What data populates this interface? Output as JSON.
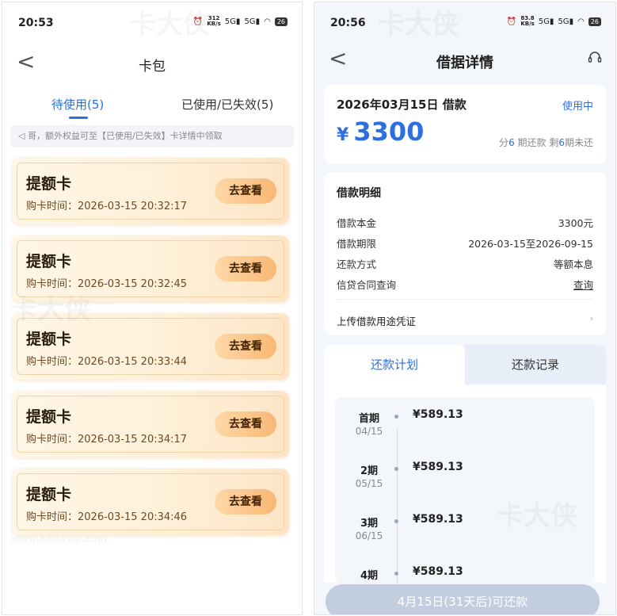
{
  "left": {
    "status": {
      "time": "20:53",
      "speed_top": "312",
      "speed_unit": "KB/s",
      "net1": "5G",
      "net2": "5G",
      "battery": "26"
    },
    "nav": {
      "back": "<",
      "title": "卡包"
    },
    "tabs": [
      {
        "label": "待使用(5)"
      },
      {
        "label": "已使用/已失效(5)"
      }
    ],
    "notice": "◁ 哥，额外权益可至【已使用/已失效】卡详情中领取",
    "cards": [
      {
        "name": "提额卡",
        "time": "购卡时间：2026-03-15 20:32:17",
        "button": "去查看"
      },
      {
        "name": "提额卡",
        "time": "购卡时间：2026-03-15 20:32:45",
        "button": "去查看"
      },
      {
        "name": "提额卡",
        "time": "购卡时间：2026-03-15 20:33:44",
        "button": "去查看"
      },
      {
        "name": "提额卡",
        "time": "购卡时间：2026-03-15 20:34:17",
        "button": "去查看"
      },
      {
        "name": "提额卡",
        "time": "购卡时间：2026-03-15 20:34:46",
        "button": "去查看"
      }
    ]
  },
  "right": {
    "status": {
      "time": "20:56",
      "speed_top": "83.8",
      "speed_unit": "KB/s",
      "net1": "5G",
      "net2": "5G",
      "battery": "26"
    },
    "nav": {
      "back": "<",
      "title": "借据详情",
      "support_icon": "headset-icon"
    },
    "loan": {
      "title": "2026年03月15日 借款",
      "status": "使用中",
      "currency": "¥",
      "amount": "3300",
      "sub_pre": "分",
      "sub_n1": "6",
      "sub_mid": " 期还款 剩",
      "sub_n2": "6",
      "sub_post": "期未还"
    },
    "detail": {
      "heading": "借款明细",
      "rows": [
        {
          "key": "借款本金",
          "value": "3300元"
        },
        {
          "key": "借款期限",
          "value": "2026-03-15至2026-09-15"
        },
        {
          "key": "还款方式",
          "value": "等额本息"
        },
        {
          "key": "信贷合同查询",
          "value": "查询"
        }
      ],
      "upload": "上传借款用途凭证",
      "upload_arrow": "›"
    },
    "tabs": [
      {
        "label": "还款计划"
      },
      {
        "label": "还款记录"
      }
    ],
    "installments": [
      {
        "label": "首期",
        "date": "04/15",
        "amount": "¥589.13"
      },
      {
        "label": "2期",
        "date": "05/15",
        "amount": "¥589.13"
      },
      {
        "label": "3期",
        "date": "06/15",
        "amount": "¥589.13"
      },
      {
        "label": "4期",
        "date": "",
        "amount": "¥589.13"
      }
    ],
    "pay_button": "4月15日(31天后)可还款"
  },
  "watermark": {
    "text": "卡大侠",
    "sub": "www.kadaxia.com"
  },
  "colors": {
    "accent": "#2c6fe0",
    "card_bg": "#fff0d9",
    "card_button": "#f8b774",
    "pay_disabled": "#c3cde0"
  }
}
